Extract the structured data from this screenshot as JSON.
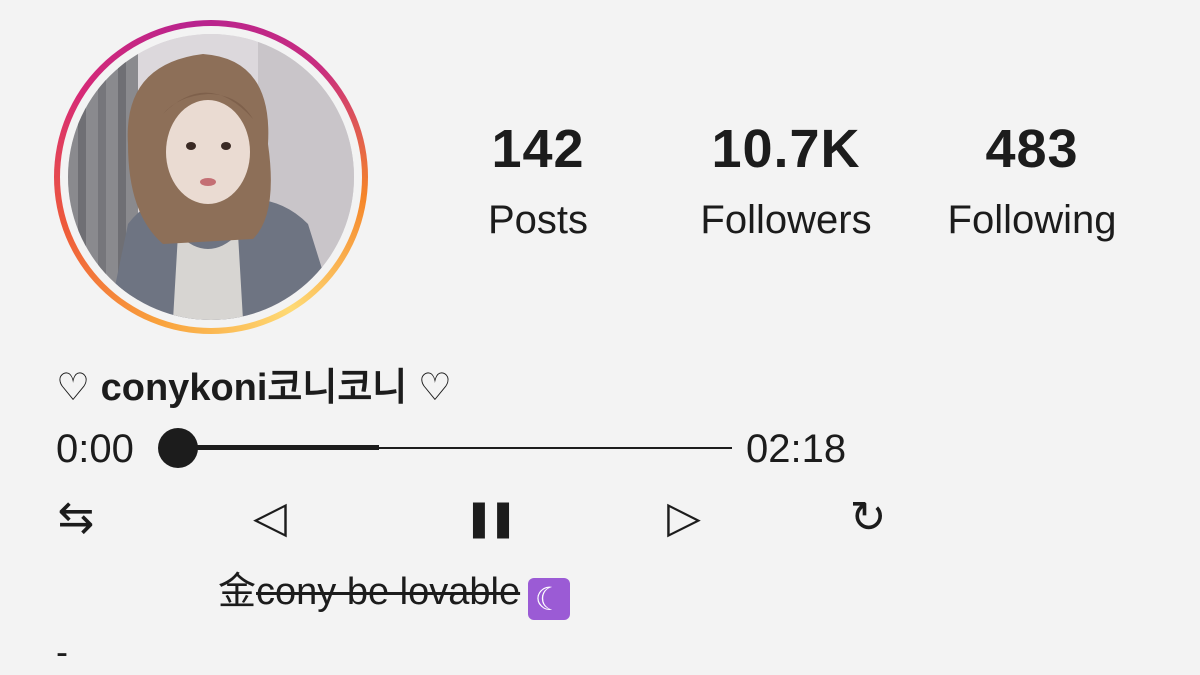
{
  "profile": {
    "avatar_alt": "profile photo",
    "username_prefix": "♡ ",
    "username": "conykoni코니코니",
    "username_suffix": " ♡",
    "bio_prefix": "金",
    "bio_strike": "cony be lovable",
    "bio_emoji": "☾",
    "bio_extra": "-"
  },
  "stats": [
    {
      "value": "142",
      "label": "Posts"
    },
    {
      "value": "10.7K",
      "label": "Followers"
    },
    {
      "value": "483",
      "label": "Following"
    }
  ],
  "player": {
    "current_time": "0:00",
    "total_time": "02:18",
    "progress": 0.36,
    "controls": {
      "shuffle": "⇆",
      "previous": "◁",
      "pause": "❚❚",
      "next": "▷",
      "repeat": "↻"
    }
  },
  "colors": {
    "background": "#f3f3f3",
    "ring_start": "#f9a13b",
    "ring_end": "#c92d7f",
    "moon_bg": "#9b5bd5"
  }
}
